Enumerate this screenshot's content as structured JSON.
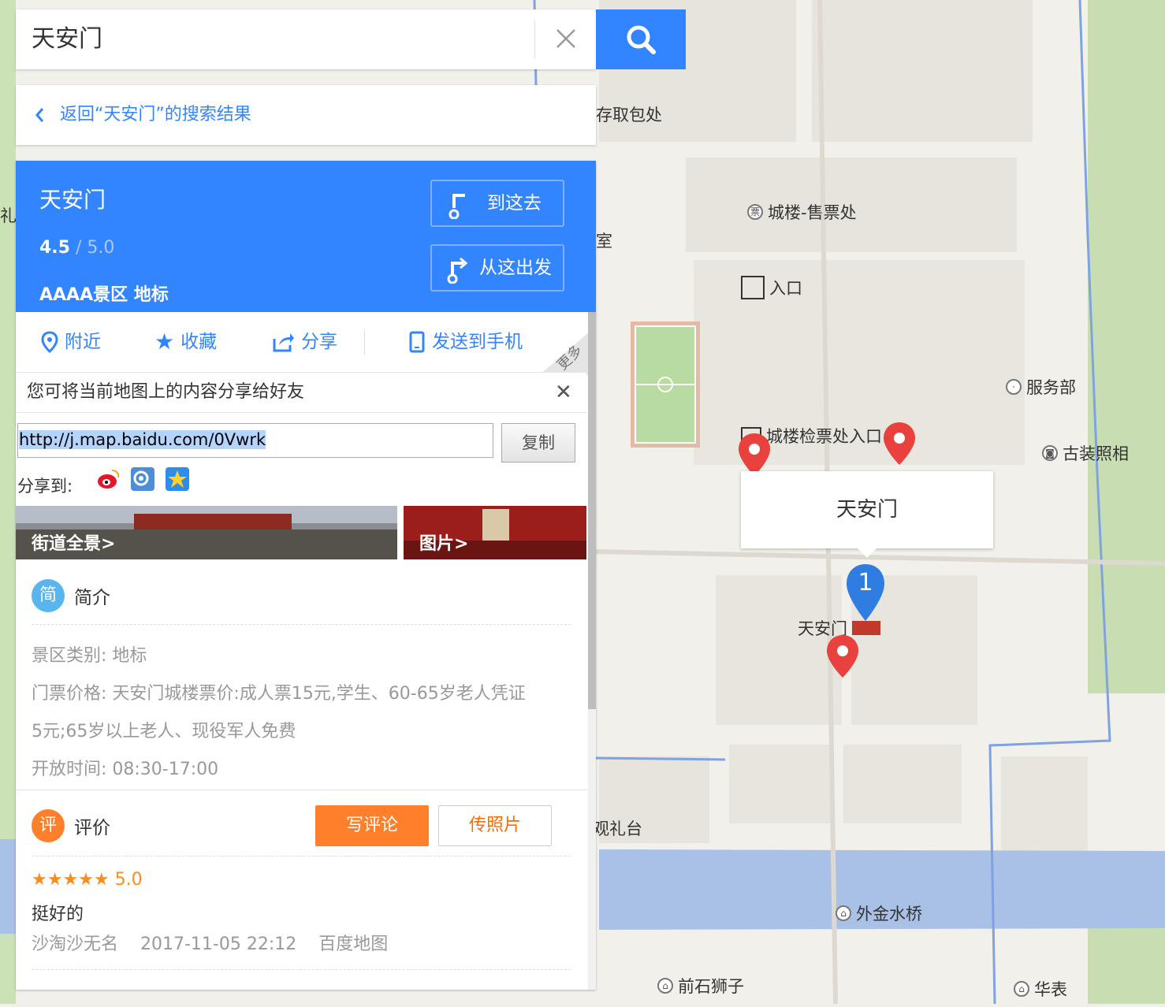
{
  "search": {
    "query": "天安门"
  },
  "back": {
    "label": "返回“天安门”的搜索结果"
  },
  "place": {
    "title": "天安门",
    "rating": "4.5",
    "rating_max": " / 5.0",
    "categories": "AAAA景区  地标",
    "go_here": "到这去",
    "from_here": "从这出发"
  },
  "actions": {
    "nearby": "附近",
    "favorite": "收藏",
    "share": "分享",
    "send_phone": "发送到手机",
    "more": "更多"
  },
  "share": {
    "title": "您可将当前地图上的内容分享给好友",
    "url": "http://j.map.baidu.com/0Vwrk",
    "copy": "复制",
    "share_to": "分享到:"
  },
  "thumbs": {
    "street": "街道全景>",
    "photos": "图片>"
  },
  "intro": {
    "badge": "简",
    "heading": "简介",
    "category_line": "景区类别:  地标",
    "ticket_line1": "门票价格:  天安门城楼票价:成人票15元,学生、60-65岁老人凭证",
    "ticket_line2": "5元;65岁以上老人、现役军人免费",
    "hours_line": "开放时间:  08:30-17:00"
  },
  "review": {
    "badge": "评",
    "heading": "评价",
    "write": "写评论",
    "upload": "传照片",
    "stars": "★★★★★",
    "score": "5.0",
    "text": "挺好的",
    "user": "沙淘沙无名",
    "time": "2017-11-05 22:12",
    "source": "百度地图"
  },
  "map": {
    "callout": "天安门",
    "marker_number": "1",
    "labels": {
      "baggage": "存取包处",
      "ticket_office": "城楼-售票处",
      "room": "室",
      "entrance": "入口",
      "service": "服务部",
      "check_entrance": "城楼检票处入口",
      "costume_photo": "古装照相",
      "tiananmen": "天安门",
      "viewing_platform": "观礼台",
      "jinshui_bridge": "外金水桥",
      "stone_lions": "前石狮子",
      "huabiao": "华表",
      "left_cut": "礼"
    }
  },
  "colors": {
    "accent": "#3385ff",
    "orange": "#ff7f2a",
    "pin_red": "#e8413e",
    "water": "#a9c1e6",
    "green": "#c8deb2"
  }
}
